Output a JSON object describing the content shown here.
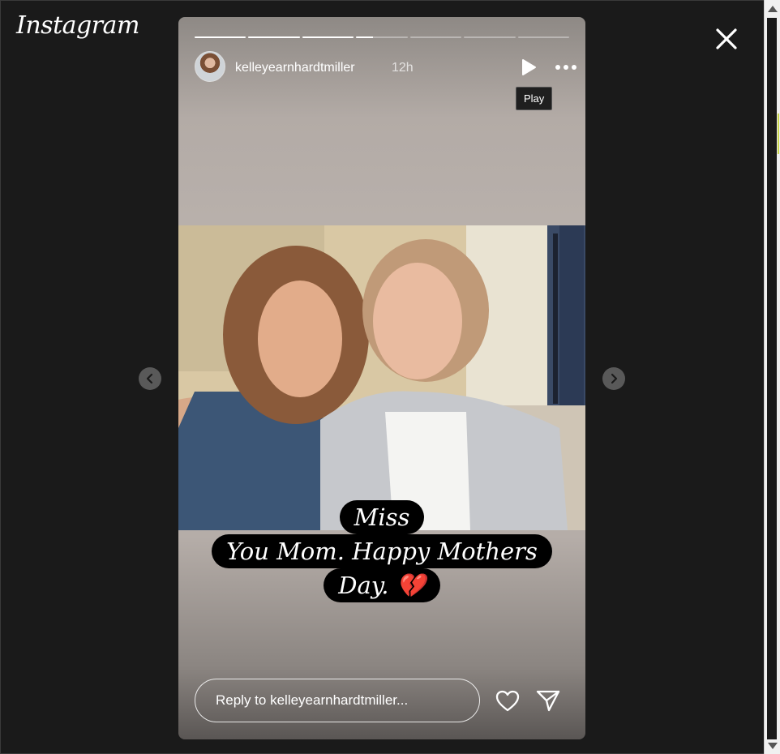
{
  "app": {
    "logo_text": "Instagram"
  },
  "story": {
    "username": "kelleyearnhardtmiller",
    "time_ago": "12h",
    "progress": [
      1,
      1,
      1,
      0.33,
      0,
      0,
      0
    ],
    "play_tooltip": "Play",
    "caption_lines": [
      "Miss",
      "You Mom. Happy Mothers",
      "Day. 💔"
    ],
    "reply_placeholder": "Reply to kelleyearnhardtmiller..."
  },
  "icons": {
    "close": "close-icon",
    "play": "play-icon",
    "more": "more-options-icon",
    "prev": "chevron-left-icon",
    "next": "chevron-right-icon",
    "like": "heart-icon",
    "share": "send-icon"
  },
  "colors": {
    "background": "#1a1a1a",
    "text": "#ffffff",
    "caption_bg": "#000000"
  }
}
